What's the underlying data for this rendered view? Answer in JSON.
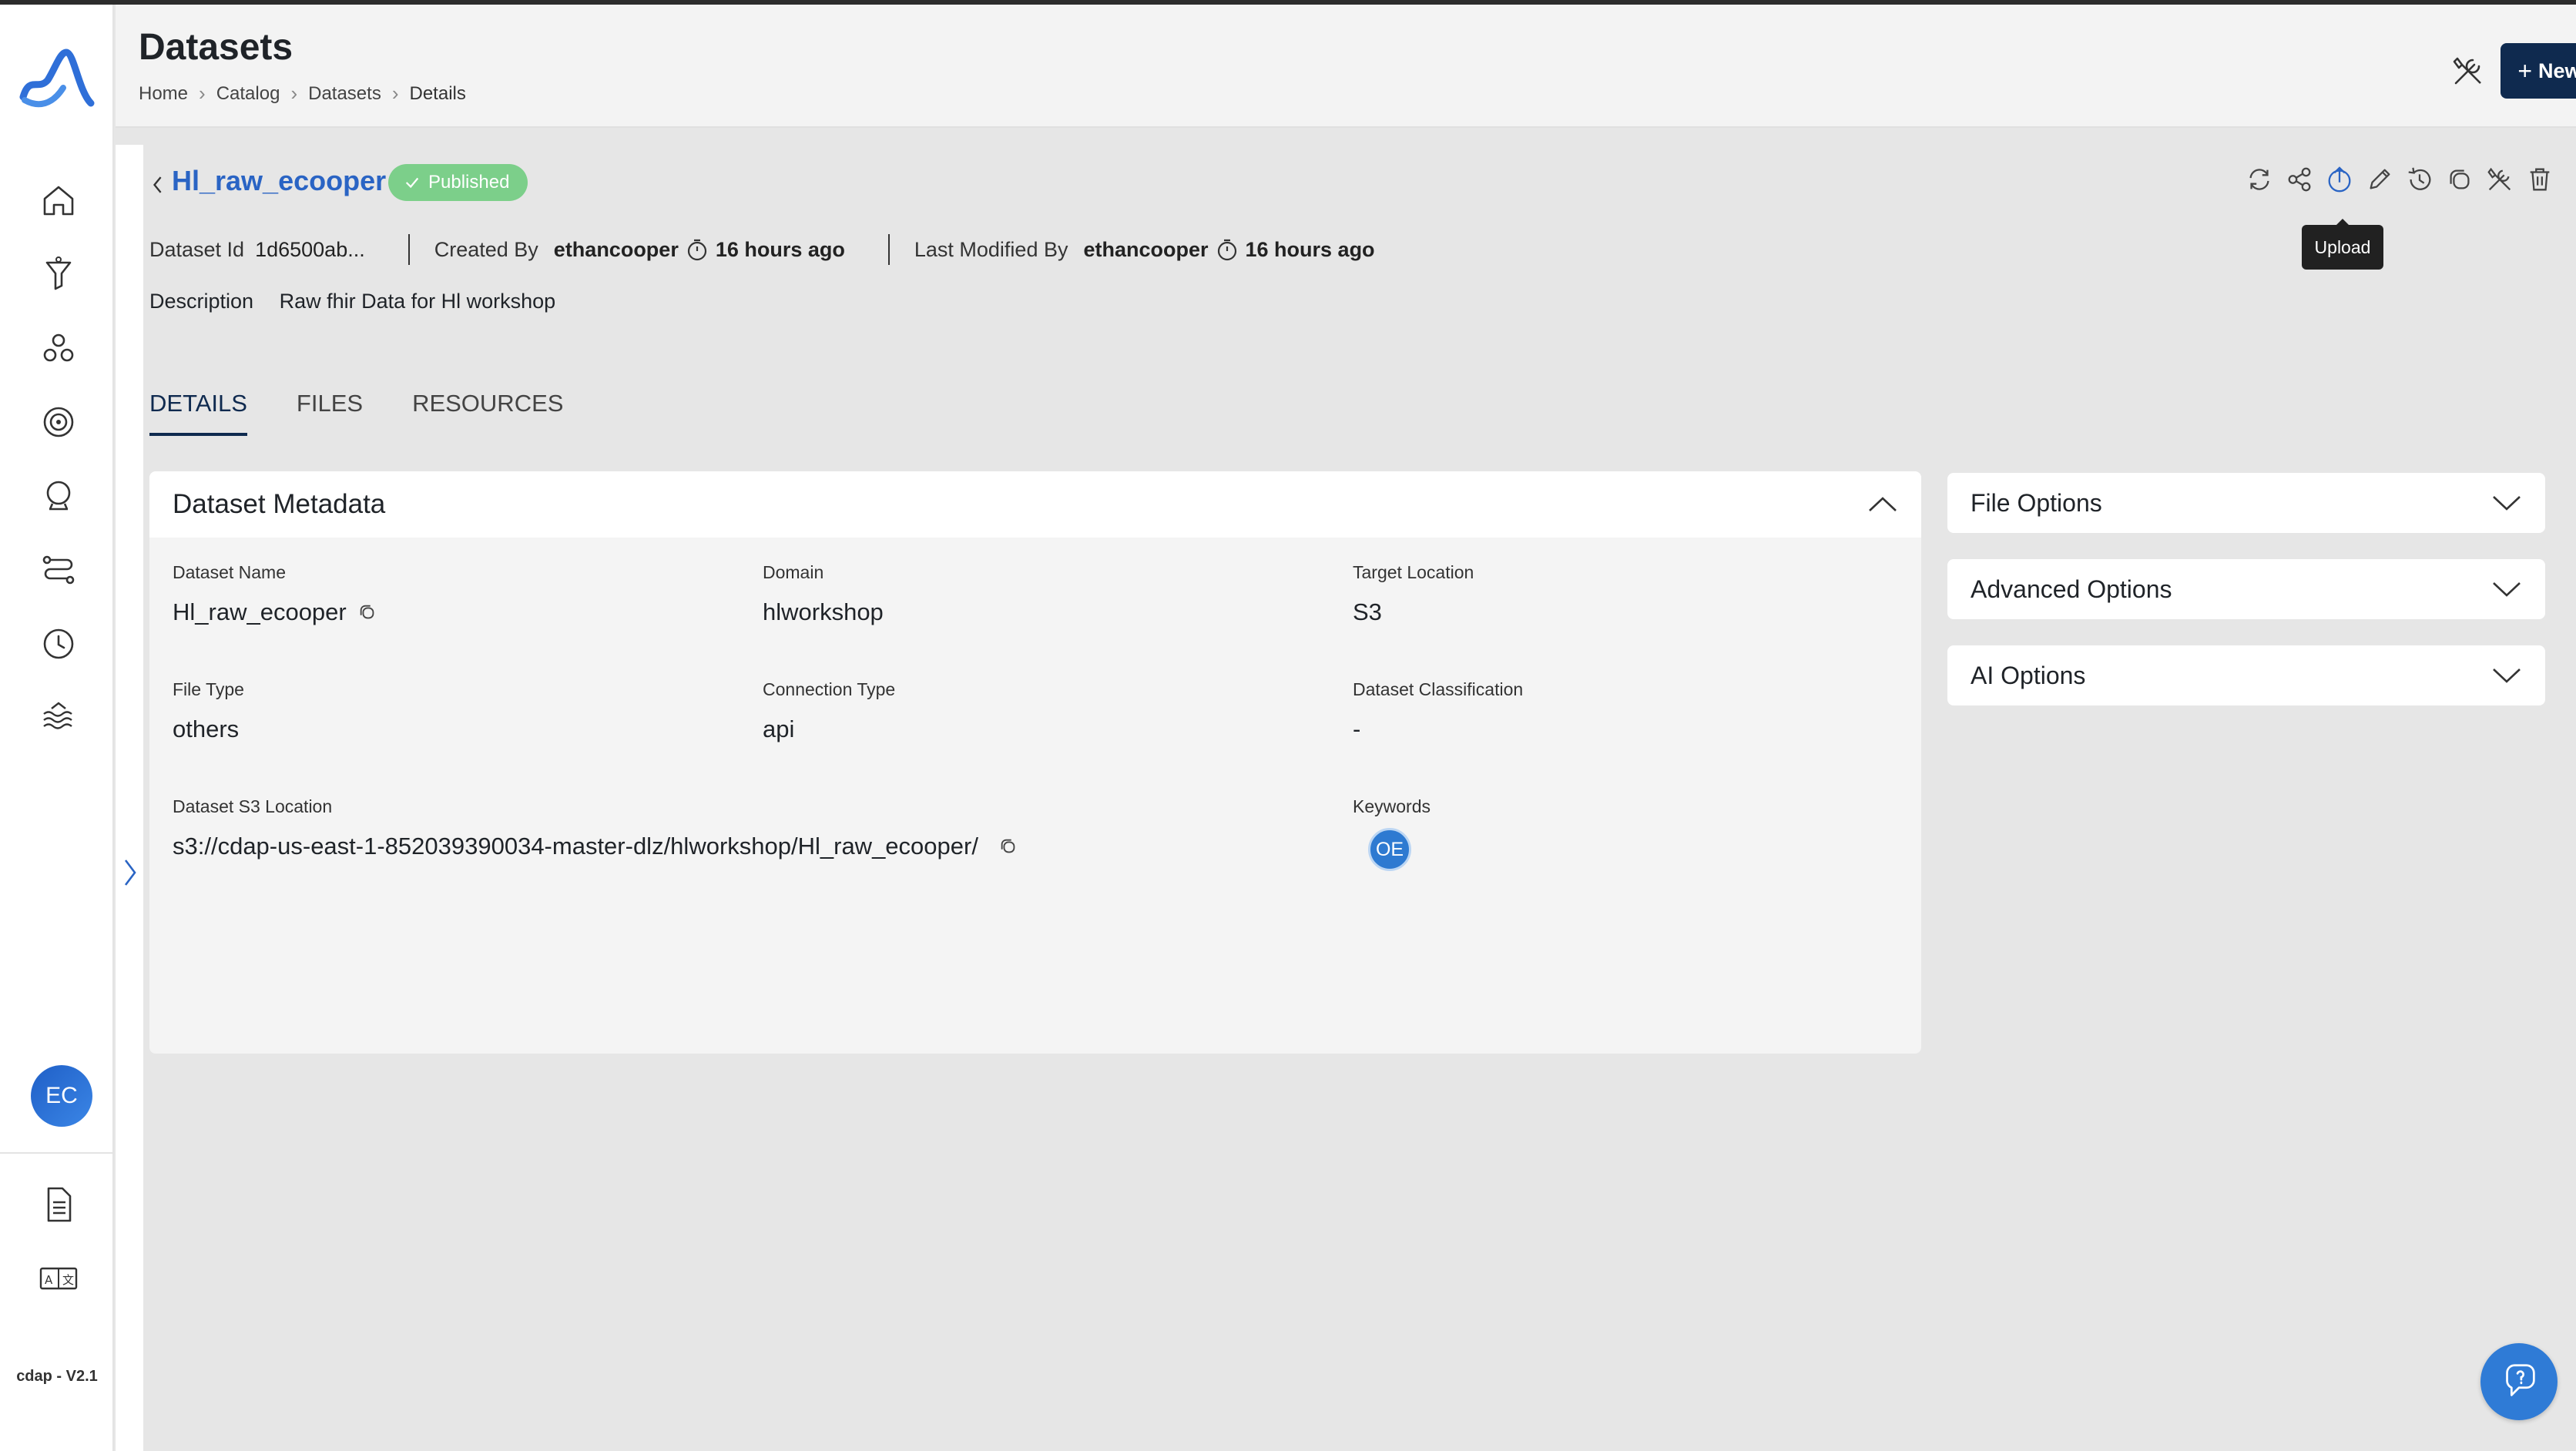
{
  "app": {
    "version": "cdap - V2.1",
    "user_initials": "EC",
    "brand_color": "#2a64c4"
  },
  "header": {
    "title": "Datasets",
    "breadcrumb": [
      "Home",
      "Catalog",
      "Datasets",
      "Details"
    ],
    "new_button_label": "New Dataset"
  },
  "sidebar": {
    "items": [
      {
        "icon": "home-icon"
      },
      {
        "icon": "funnel-icon"
      },
      {
        "icon": "cluster-icon"
      },
      {
        "icon": "target-icon"
      },
      {
        "icon": "crystal-ball-icon"
      },
      {
        "icon": "pipeline-icon"
      },
      {
        "icon": "clock-icon"
      },
      {
        "icon": "data-lake-icon"
      }
    ],
    "bottom_items": [
      {
        "icon": "document-icon"
      },
      {
        "icon": "translate-icon"
      }
    ]
  },
  "dataset": {
    "name": "Hl_raw_ecooper",
    "status": "Published",
    "status_color": "#7ccf8a",
    "id_label": "Dataset Id",
    "id_value": "1d6500ab...",
    "created_by_label": "Created By",
    "created_by": "ethancooper",
    "created_time": "16 hours ago",
    "modified_by_label": "Last Modified By",
    "modified_by": "ethancooper",
    "modified_time": "16 hours ago",
    "description_label": "Description",
    "description": "Raw fhir Data for Hl workshop"
  },
  "actions": {
    "icons": [
      "refresh-icon",
      "share-icon",
      "upload-icon",
      "edit-icon",
      "history-icon",
      "copy-icon",
      "tools-icon",
      "delete-icon"
    ],
    "tooltip": "Upload"
  },
  "tabs": [
    "DETAILS",
    "FILES",
    "RESOURCES"
  ],
  "metadata": {
    "title": "Dataset Metadata",
    "fields": {
      "dataset_name": {
        "label": "Dataset Name",
        "value": "Hl_raw_ecooper"
      },
      "domain": {
        "label": "Domain",
        "value": "hlworkshop"
      },
      "target_location": {
        "label": "Target Location",
        "value": "S3"
      },
      "file_type": {
        "label": "File Type",
        "value": "others"
      },
      "connection_type": {
        "label": "Connection Type",
        "value": "api"
      },
      "classification": {
        "label": "Dataset Classification",
        "value": "-"
      },
      "s3_location": {
        "label": "Dataset S3 Location",
        "value": "s3://cdap-us-east-1-852039390034-master-dlz/hlworkshop/Hl_raw_ecooper/"
      },
      "keywords": {
        "label": "Keywords",
        "values": [
          "OE"
        ]
      }
    }
  },
  "options": [
    "File Options",
    "Advanced Options",
    "AI Options"
  ]
}
